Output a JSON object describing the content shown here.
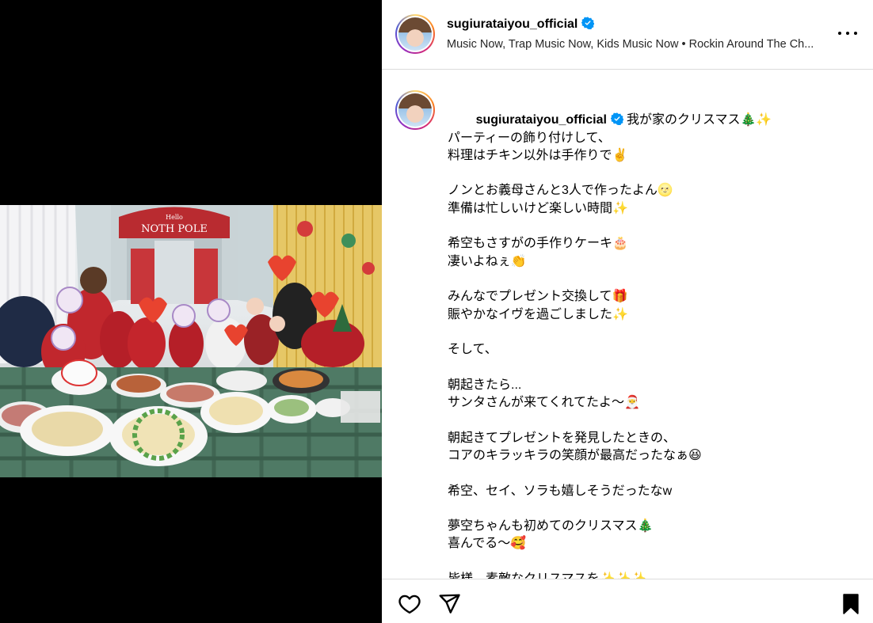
{
  "post": {
    "username": "sugiurataiyou_official",
    "verified_icon": "verified-badge-icon",
    "music": "Music Now, Trap Music Now, Kids Music Now • Rockin Around The Ch...",
    "photo_texts": {
      "sign_small": "Hello",
      "sign_main": "NOTH POLE"
    }
  },
  "caption": {
    "username": "sugiurataiyou_official",
    "first_line": "我が家のクリスマス🎄✨",
    "lines": [
      "",
      "パーティーの飾り付けして、",
      "料理はチキン以外は手作りで✌️",
      "",
      "ノンとお義母さんと3人で作ったよん🌝",
      "準備は忙しいけど楽しい時間✨",
      "",
      "希空もさすがの手作りケーキ🎂",
      "凄いよねぇ👏",
      "",
      "みんなでプレゼント交換して🎁",
      "賑やかなイヴを過ごしました✨",
      "",
      "そして、",
      "",
      "朝起きたら...",
      "サンタさんが来てくれてたよ〜🎅",
      "",
      "朝起きてプレゼントを発見したときの、",
      "コアのキラッキラの笑顔が最高だったなぁ😆",
      "",
      "希空、セイ、ソラも嬉しそうだったなw",
      "",
      "夢空ちゃんも初めてのクリスマス🎄",
      "喜んでる〜🥰",
      "",
      "皆様、素敵なクリスマスを✨✨✨"
    ]
  },
  "actions": {
    "like": "heart-icon",
    "share": "send-icon",
    "save": "bookmark-icon"
  },
  "colors": {
    "verified": "#0095f6",
    "border": "#dbdbdb",
    "media_bg": "#000000"
  }
}
